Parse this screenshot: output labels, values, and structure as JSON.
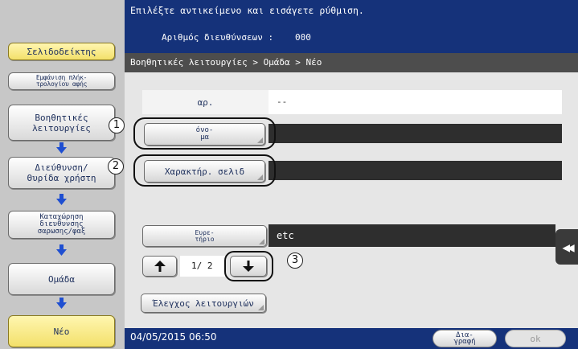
{
  "sidebar": {
    "top_button": "Σελιδοδείκτης",
    "display_button": "Εμφάνιση πλήκ-\nτρολογίου αφής",
    "steps": [
      {
        "label": "Βοηθητικές\nλειτουργίες",
        "marker": "1"
      },
      {
        "label": "Διεύθυνση/\nΘυρίδα χρήστη",
        "marker": "2"
      },
      {
        "label": "Καταχώρηση\nδιευθυνσης\nσαρωσης/φαξ"
      },
      {
        "label": "Ομάδα"
      },
      {
        "label": "Νέο"
      }
    ]
  },
  "header": {
    "instruction": "Επιλέξτε αντικείμενο και εισάγετε ρύθμιση.",
    "address_count_label": "Αριθμός διευθύνσεων :",
    "address_count_value": "000",
    "breadcrumb": "Βοηθητικές λειτουργίες > Ομάδα > Νέο"
  },
  "form": {
    "number_label": "αρ.",
    "number_value": "--",
    "name_button": "όνο-\nμα",
    "char_button": "Χαρακτήρ. σελιδ",
    "index_button": "Ευρε-\nτήριο",
    "index_value": "etc",
    "page_indicator": "1/ 2",
    "function_check_button": "Έλεγχος λειτουργιών",
    "step3_marker": "3"
  },
  "footer": {
    "datetime": "04/05/2015  06:50",
    "delete_button": "Δια-\nγραφή",
    "ok_button": "ok"
  },
  "icons": {
    "up": "arrow-up-icon",
    "down": "arrow-down-icon",
    "step_arrow": "arrow-down-blue-icon",
    "side_tab": "double-chevron-left-icon"
  },
  "colors": {
    "header_bg": "#15327a",
    "breadcrumb_bg": "#4d4d4d",
    "highlight_yellow": "#f3e06a",
    "step_arrow": "#1f4fd1"
  }
}
